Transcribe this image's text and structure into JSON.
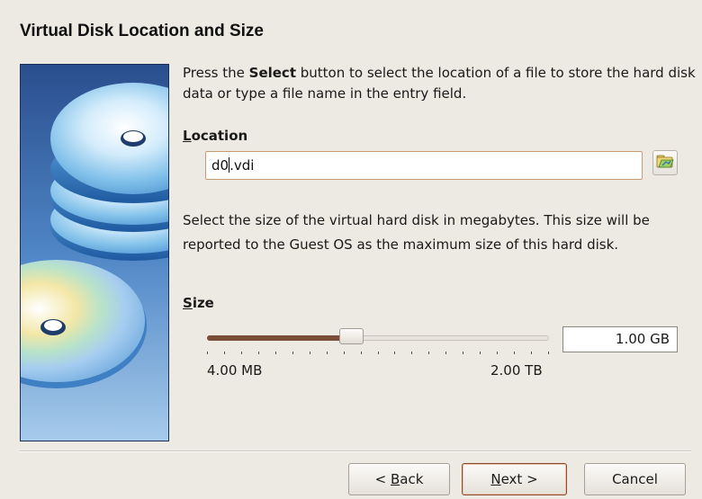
{
  "dialog": {
    "title": "Virtual Disk Location and Size"
  },
  "intro": {
    "before_bold": "Press the ",
    "bold": "Select",
    "after_bold": " button to select the location of a file to store the hard disk data or type a file name in the entry field."
  },
  "location": {
    "label_mnemonic": "L",
    "label_rest": "ocation",
    "value_before_caret": "d0",
    "value_after_caret": ".vdi",
    "browse_icon": "folder-open-icon"
  },
  "size_description": "Select the size of the virtual hard disk in megabytes. This size will be reported to the Guest OS as the maximum size of this hard disk.",
  "size": {
    "label_mnemonic": "S",
    "label_rest": "ize",
    "min_label": "4.00 MB",
    "max_label": "2.00 TB",
    "value": "1.00 GB",
    "slider_fraction": 0.42,
    "tick_count": 20
  },
  "buttons": {
    "back_pre": "< ",
    "back_mnemonic": "B",
    "back_rest": "ack",
    "next_mnemonic": "N",
    "next_rest": "ext >",
    "cancel": "Cancel"
  },
  "colors": {
    "background": "#ede9e3",
    "slider_fill": "#7a4f3a",
    "art_top": "#2a4e8e",
    "art_bottom": "#9ac1e8"
  }
}
